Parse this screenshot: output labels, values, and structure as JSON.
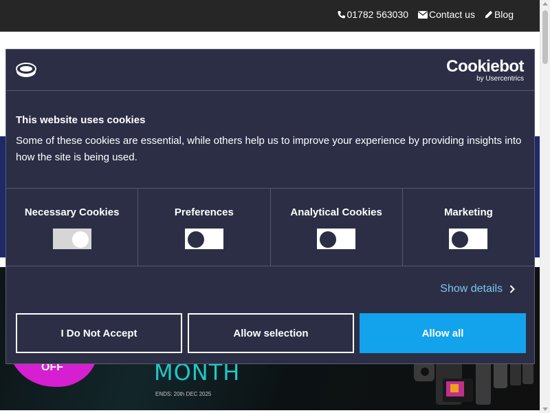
{
  "topbar": {
    "phone": "01782 563030",
    "contact": "Contact us",
    "blog": "Blog"
  },
  "hero": {
    "badge_text": "OFF",
    "title": "MONTH",
    "ends": "ENDS: 20th DEC 2025"
  },
  "cookie": {
    "brand_name": "Cookiebot",
    "brand_sub": "by Usercentrics",
    "heading": "This website uses cookies",
    "text": "Some of these cookies are essential, while others help us to improve your experience by providing insights into how the site is being used.",
    "categories": [
      {
        "label": "Necessary Cookies",
        "state": "on"
      },
      {
        "label": "Preferences",
        "state": "off"
      },
      {
        "label": "Analytical Cookies",
        "state": "off"
      },
      {
        "label": "Marketing",
        "state": "off"
      }
    ],
    "show_details": "Show details",
    "buttons": {
      "deny": "I Do Not Accept",
      "selection": "Allow selection",
      "allow_all": "Allow all"
    }
  },
  "colors": {
    "topbar": "#262626",
    "dialog_bg": "#2b2e45",
    "accent": "#12a3ec",
    "link": "#7ec8f0",
    "nav_band": "#1f2a66"
  }
}
